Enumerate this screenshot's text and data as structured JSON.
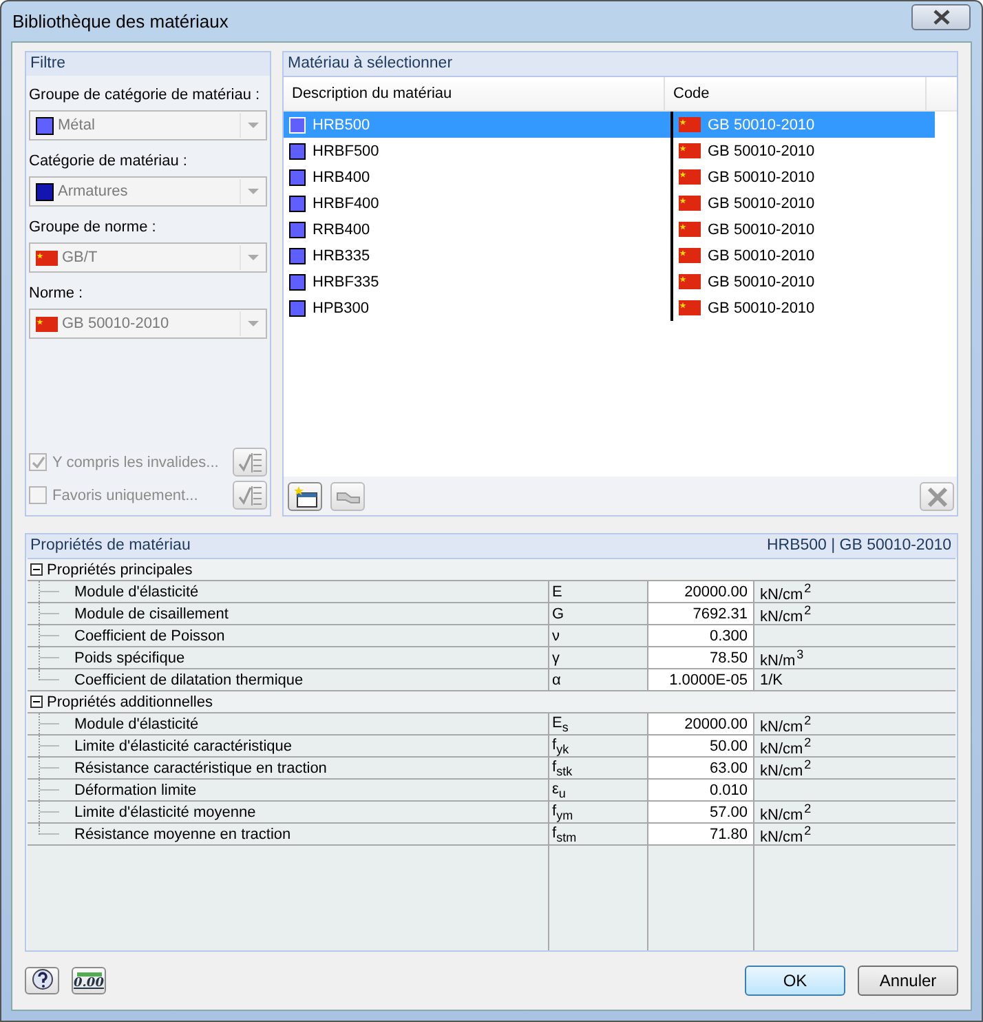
{
  "window": {
    "title": "Bibliothèque des matériaux"
  },
  "filter": {
    "title": "Filtre",
    "fields": [
      {
        "label": "Groupe de catégorie de matériau :",
        "value": "Métal",
        "disabled": true,
        "kind": "swatch",
        "color": "#6060ff"
      },
      {
        "label": "Catégorie de matériau :",
        "value": "Armatures",
        "disabled": true,
        "kind": "swatch",
        "color": "#1414b0"
      },
      {
        "label": "Groupe de norme :",
        "value": "GB/T",
        "disabled": true,
        "kind": "flag"
      },
      {
        "label": "Norme :",
        "value": "GB 50010-2010",
        "disabled": true,
        "kind": "flag"
      }
    ],
    "checks": [
      {
        "label": "Y compris les invalides...",
        "checked": true,
        "disabled": true
      },
      {
        "label": "Favoris uniquement...",
        "checked": false,
        "disabled": true
      }
    ]
  },
  "materials": {
    "title": "Matériau à sélectionner",
    "columns": [
      "Description du matériau",
      "Code"
    ],
    "rows": [
      {
        "name": "HRB500",
        "code": "GB 50010-2010",
        "selected": true
      },
      {
        "name": "HRBF500",
        "code": "GB 50010-2010",
        "selected": false
      },
      {
        "name": "HRB400",
        "code": "GB 50010-2010",
        "selected": false
      },
      {
        "name": "HRBF400",
        "code": "GB 50010-2010",
        "selected": false
      },
      {
        "name": "RRB400",
        "code": "GB 50010-2010",
        "selected": false
      },
      {
        "name": "HRB335",
        "code": "GB 50010-2010",
        "selected": false
      },
      {
        "name": "HRBF335",
        "code": "GB 50010-2010",
        "selected": false
      },
      {
        "name": "HPB300",
        "code": "GB 50010-2010",
        "selected": false
      }
    ]
  },
  "properties": {
    "title": "Propriétés de matériau",
    "selection": "HRB500  |  GB 50010-2010",
    "groups": [
      {
        "name": "Propriétés principales",
        "expanded": true,
        "rows": [
          {
            "name": "Module d'élasticité",
            "symbol": "E",
            "value": "20000.00",
            "unit": "kN/cm$^{2}$"
          },
          {
            "name": "Module de cisaillement",
            "symbol": "G",
            "value": "7692.31",
            "unit": "kN/cm$^{2}$"
          },
          {
            "name": "Coefficient de Poisson",
            "symbol": "ν",
            "value": "0.300"
          },
          {
            "name": "Poids spécifique",
            "symbol": "γ",
            "value": "78.50",
            "unit": "kN/m$^{3}$"
          },
          {
            "name": "Coefficient de dilatation thermique",
            "symbol": "α",
            "value": "1.0000E-05",
            "unit": "1/K"
          }
        ]
      },
      {
        "name": "Propriétés additionnelles",
        "expanded": true,
        "rows": [
          {
            "name": "Module d'élasticité",
            "symbol": "E$_{s}$",
            "value": "20000.00",
            "unit": "kN/cm$^{2}$"
          },
          {
            "name": "Limite d'élasticité caractéristique",
            "symbol": "f$_{yk}$",
            "value": "50.00",
            "unit": "kN/cm$^{2}$"
          },
          {
            "name": "Résistance caractéristique en traction",
            "symbol": "f$_{stk}$",
            "value": "63.00",
            "unit": "kN/cm$^{2}$"
          },
          {
            "name": "Déformation limite",
            "symbol": "ε$_{u}$",
            "value": "0.010"
          },
          {
            "name": "Limite d'élasticité moyenne",
            "symbol": "f$_{ym}$",
            "value": "57.00",
            "unit": "kN/cm$^{2}$"
          },
          {
            "name": "Résistance moyenne en traction",
            "symbol": "f$_{stm}$",
            "value": "71.80",
            "unit": "kN/cm$^{2}$"
          }
        ]
      }
    ]
  },
  "footer": {
    "units_icon_text": "0.00",
    "buttons": [
      "OK",
      "Annuler"
    ]
  }
}
